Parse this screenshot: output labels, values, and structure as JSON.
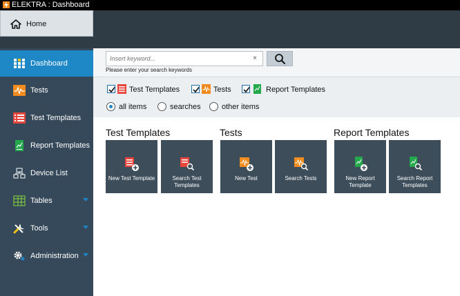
{
  "window": {
    "title": "ELEKTRA : Dashboard"
  },
  "home": {
    "label": "Home"
  },
  "sidebar": {
    "items": [
      {
        "label": "Dashboard"
      },
      {
        "label": "Tests"
      },
      {
        "label": "Test Templates"
      },
      {
        "label": "Report Templates"
      },
      {
        "label": "Device List"
      },
      {
        "label": "Tables"
      },
      {
        "label": "Tools"
      },
      {
        "label": "Administration"
      }
    ]
  },
  "search": {
    "placeholder": "Insert keyword...",
    "clear_symbol": "×",
    "hint": "Please enter your search keywords"
  },
  "filters": {
    "checkboxes": [
      {
        "label": "Test Templates",
        "checked": true
      },
      {
        "label": "Tests",
        "checked": true
      },
      {
        "label": "Report Templates",
        "checked": true
      }
    ],
    "radios": [
      {
        "label": "all items",
        "selected": true
      },
      {
        "label": "searches",
        "selected": false
      },
      {
        "label": "other items",
        "selected": false
      }
    ]
  },
  "sections": [
    {
      "title": "Test Templates",
      "tiles": [
        {
          "label": "New Test Template"
        },
        {
          "label": "Search Test Templates"
        }
      ]
    },
    {
      "title": "Tests",
      "tiles": [
        {
          "label": "New Test"
        },
        {
          "label": "Search Tests"
        }
      ]
    },
    {
      "title": "Report Templates",
      "tiles": [
        {
          "label": "New Report Template"
        },
        {
          "label": "Search Report Templates"
        }
      ]
    }
  ],
  "colors": {
    "sidebar_bg": "#36495a",
    "active_item": "#1e88c7",
    "tile_bg": "#3d4d5a",
    "test_template_icon": "#e8453c",
    "test_icon": "#f28b1e",
    "report_icon": "#23a84b"
  },
  "icons": {
    "app": "lightning-icon",
    "home": "home-icon",
    "dashboard": "grid-icon",
    "tests": "waveform-icon",
    "test_templates": "list-icon",
    "report_templates": "report-icon",
    "device_list": "devices-icon",
    "tables": "table-icon",
    "tools": "wrench-icon",
    "administration": "gear-icon",
    "search": "search-icon"
  }
}
